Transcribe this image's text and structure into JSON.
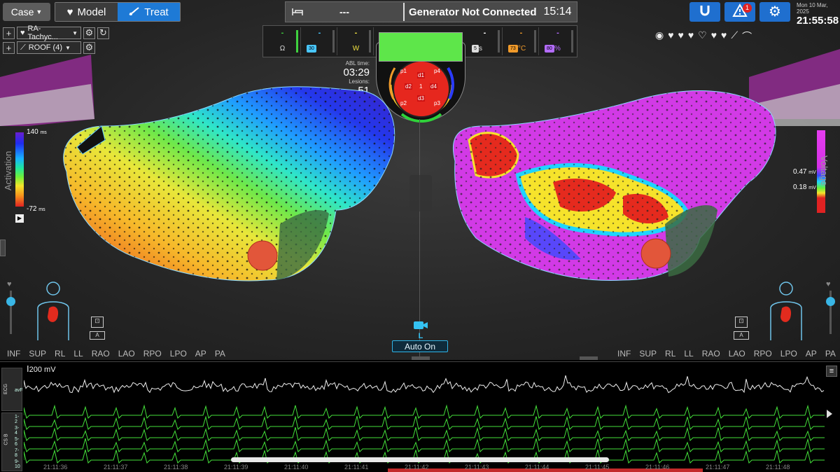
{
  "topbar": {
    "case_label": "Case",
    "model_label": "Model",
    "treat_label": "Treat",
    "bed_dash": "---",
    "generator_status": "Generator Not Connected",
    "clock": "15:14",
    "alert_count": "1",
    "date": "Mon 10 Mar, 2025",
    "time": "21:55:58"
  },
  "maps": {
    "map1_label": "RA-Tachyc...",
    "map2_label": "ROOF (4)"
  },
  "generator": {
    "impedance_value": "-",
    "impedance_unit": "Ω",
    "flow_value": "-",
    "flow_badge": "30",
    "power_value": "-",
    "power_unit": "W",
    "time_value": "-",
    "time_badge": "5",
    "temp_value": "-",
    "temp_badge": "73",
    "percent_value": "-",
    "percent_badge": "80",
    "percent_unit": "%",
    "temp_unit": "°C",
    "time_unit": "s"
  },
  "ablation": {
    "abl_time_label": "ABL time:",
    "abl_time": "03:29",
    "lesions_label": "Lesions:",
    "lesions": "51"
  },
  "catheter": {
    "electrodes": [
      "p1",
      "d1",
      "p4",
      "d2",
      "1",
      "d4",
      "d3",
      "p2",
      "p3"
    ]
  },
  "activation_scale": {
    "title": "Activation",
    "max": "140",
    "min": "-72",
    "unit": "ms"
  },
  "voltage_scale": {
    "title": "Voltage",
    "high": "0.47",
    "low": "0.18",
    "unit": "mV"
  },
  "camera": {
    "label": "L",
    "auto_label": "Auto On"
  },
  "views_left": [
    "INF",
    "SUP",
    "RL",
    "LL",
    "RAO",
    "LAO",
    "RPO",
    "LPO",
    "AP",
    "PA"
  ],
  "views_right": [
    "INF",
    "SUP",
    "RL",
    "LL",
    "RAO",
    "LAO",
    "RPO",
    "LPO",
    "AP",
    "PA"
  ],
  "ecg": {
    "scale_label": "200 mV",
    "ecg_group": "ECG",
    "ecg_channel": "avF",
    "cs_group": "CS B",
    "cs_channels": [
      "1-2",
      "3-4",
      "5-6",
      "7-8",
      "9-10"
    ],
    "time_ticks": [
      "21:11:36",
      "21:11:37",
      "21:11:38",
      "21:11:39",
      "21:11:40",
      "21:11:41",
      "21:11:42",
      "21:11:43",
      "21:11:44",
      "21:11:45",
      "21:11:46",
      "21:11:47",
      "21:11:48"
    ]
  },
  "colors": {
    "accent": "#1f6fcf",
    "alert": "#e02222",
    "trace": "#44e03a"
  }
}
